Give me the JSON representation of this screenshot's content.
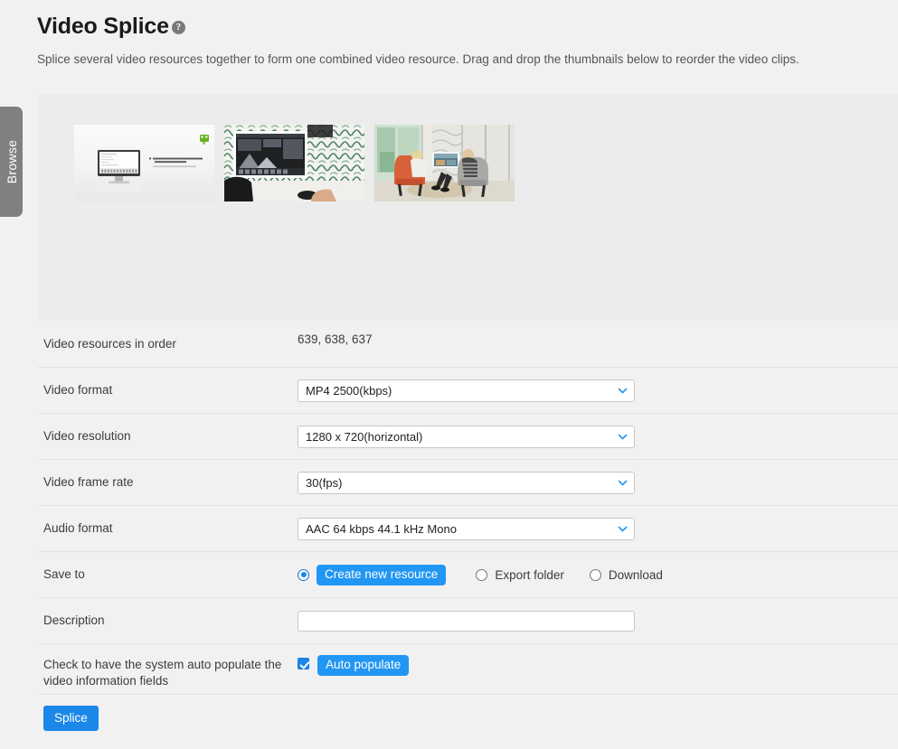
{
  "sidebar": {
    "browse_tab_label": "Browse"
  },
  "header": {
    "title": "Video Splice",
    "help_icon_glyph": "?",
    "description": "Splice several video resources together to form one combined video resource. Drag and drop the thumbnails below to reorder the video clips."
  },
  "drop_area": {
    "thumbnails": [
      {
        "alt": "video-thumbnail-639"
      },
      {
        "alt": "video-thumbnail-638"
      },
      {
        "alt": "video-thumbnail-637"
      }
    ]
  },
  "form": {
    "resources_row": {
      "label": "Video resources in order",
      "value": "639, 638, 637"
    },
    "video_format": {
      "label": "Video format",
      "value": "MP4 2500(kbps)"
    },
    "video_resolution": {
      "label": "Video resolution",
      "value": "1280 x 720(horizontal)"
    },
    "video_frame_rate": {
      "label": "Video frame rate",
      "value": "30(fps)"
    },
    "audio_format": {
      "label": "Audio format",
      "value": "AAC 64 kbps 44.1 kHz Mono"
    },
    "save_to": {
      "label": "Save to",
      "options": [
        {
          "label": "Create new resource",
          "selected": true,
          "style": "pill"
        },
        {
          "label": "Export folder",
          "selected": false,
          "style": "text"
        },
        {
          "label": "Download",
          "selected": false,
          "style": "text"
        }
      ]
    },
    "description": {
      "label": "Description",
      "value": "",
      "placeholder": ""
    },
    "auto_populate": {
      "label": "Check to have the system auto populate the video information fields",
      "checked": true,
      "button_label": "Auto populate"
    }
  },
  "actions": {
    "splice_label": "Splice"
  },
  "colors": {
    "accent": "#1b87e8",
    "pill": "#2196f3",
    "page_bg": "#f1f1f1",
    "drop_bg": "#ececec",
    "tab_bg": "#808080"
  }
}
